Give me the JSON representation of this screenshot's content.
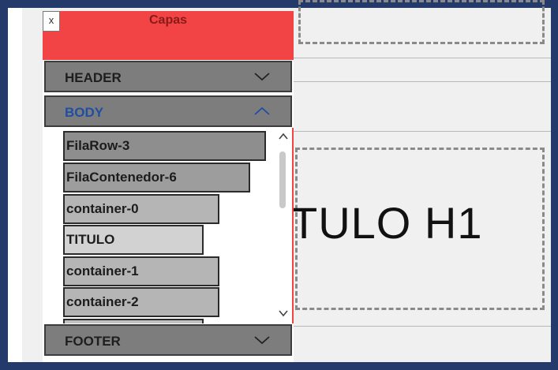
{
  "panel": {
    "title": "Capas",
    "close_label": "x",
    "sections": [
      {
        "label": "HEADER",
        "state": "collapsed"
      },
      {
        "label": "BODY",
        "state": "expanded"
      },
      {
        "label": "FOOTER",
        "state": "collapsed"
      }
    ],
    "body_items": [
      {
        "label": "FilaRow-3"
      },
      {
        "label": "FilaContenedor-6"
      },
      {
        "label": "container-0"
      },
      {
        "label": "TITULO"
      },
      {
        "label": "container-1"
      },
      {
        "label": "container-2"
      }
    ]
  },
  "canvas": {
    "heading_text": "TULO H1"
  },
  "colors": {
    "frame": "#233a6b",
    "panel_header": "#f24444",
    "active_section_text": "#1f4ea3"
  }
}
